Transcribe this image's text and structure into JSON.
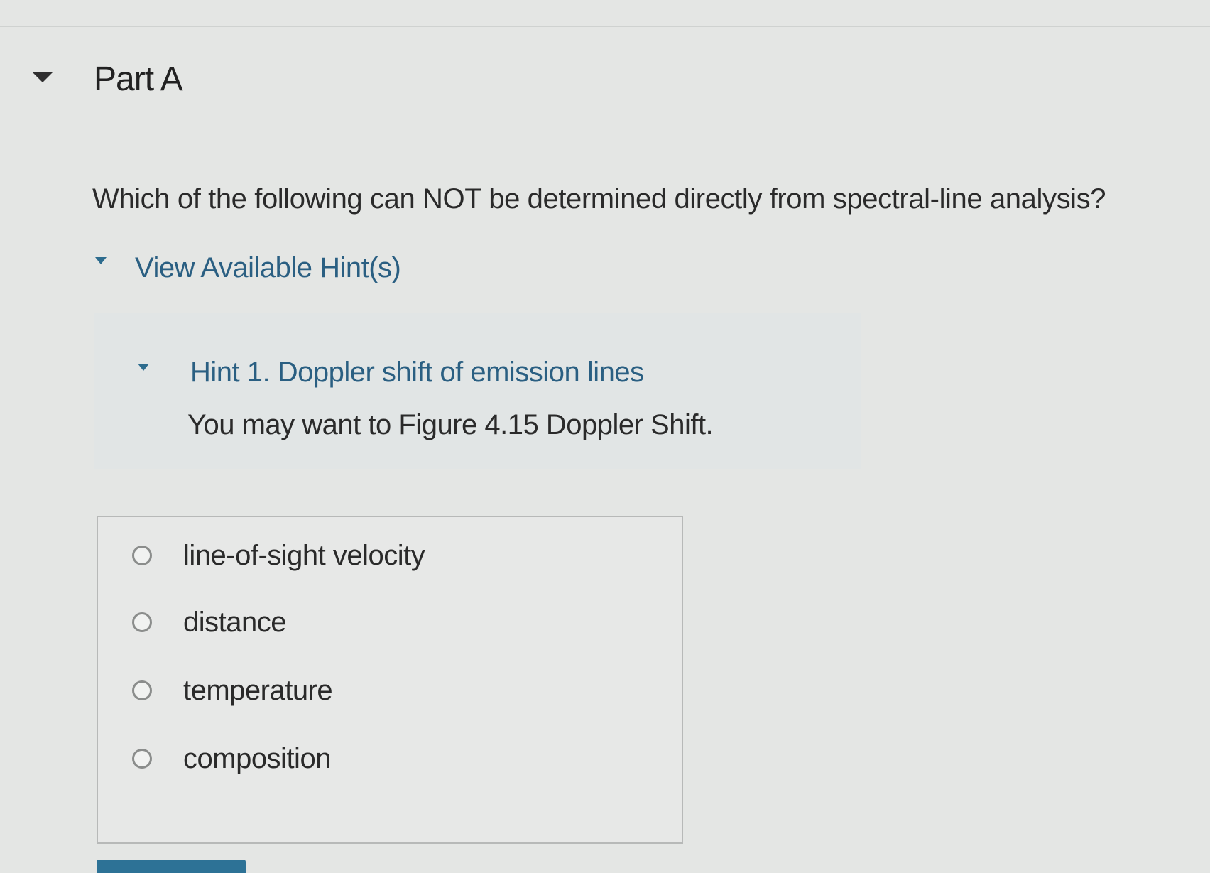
{
  "part": {
    "title": "Part A"
  },
  "question": {
    "text": "Which of the following can NOT be determined directly from spectral-line analysis?"
  },
  "hints": {
    "toggle_label": "View Available Hint(s)",
    "items": [
      {
        "title": "Hint 1. Doppler shift of emission lines",
        "body": "You may want to Figure 4.15 Doppler Shift."
      }
    ]
  },
  "choices": [
    {
      "label": "line-of-sight velocity",
      "selected": false
    },
    {
      "label": "distance",
      "selected": false
    },
    {
      "label": "temperature",
      "selected": false
    },
    {
      "label": "composition",
      "selected": false
    }
  ],
  "colors": {
    "link": "#2a5f82",
    "button": "#2d7296",
    "background": "#e4e6e4"
  }
}
